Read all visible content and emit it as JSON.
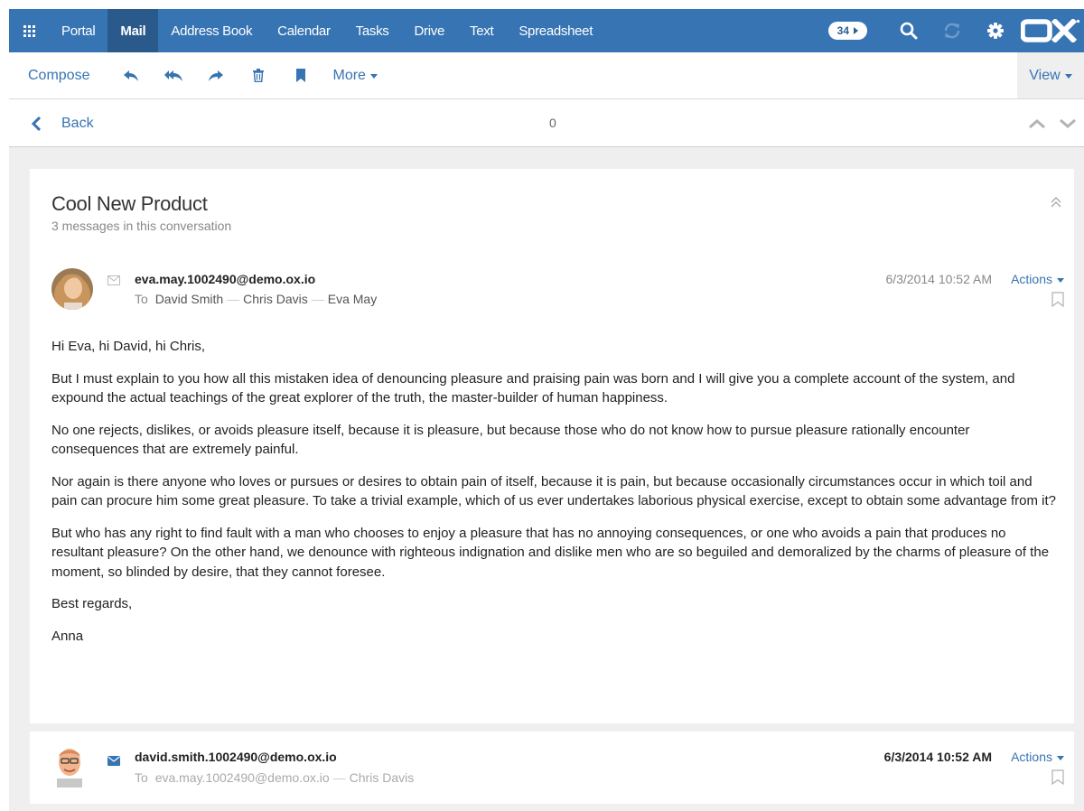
{
  "topbar": {
    "nav": [
      "Portal",
      "Mail",
      "Address Book",
      "Calendar",
      "Tasks",
      "Drive",
      "Text",
      "Spreadsheet"
    ],
    "active": "Mail",
    "notification_count": "34",
    "icons": [
      "apps-icon",
      "search-icon",
      "refresh-icon",
      "gear-icon",
      "ox-logo"
    ],
    "accent": "#3774b3"
  },
  "toolbar": {
    "compose": "Compose",
    "icons": [
      "reply-icon",
      "reply-all-icon",
      "forward-icon",
      "delete-icon",
      "flag-icon"
    ],
    "more": "More",
    "view": "View"
  },
  "detail_bar": {
    "back": "Back",
    "counter": "0"
  },
  "conversation": {
    "subject": "Cool New Product",
    "count_text": "3 messages in this conversation",
    "messages": [
      {
        "from": "eva.may.1002490@demo.ox.io",
        "to_label": "To",
        "to": [
          "David Smith",
          "Chris Davis",
          "Eva May"
        ],
        "date": "6/3/2014 10:52 AM",
        "actions": "Actions",
        "read": true,
        "body": [
          "Hi Eva, hi David, hi Chris,",
          "But I must explain to you how all this mistaken idea of denouncing pleasure and praising pain was born and I will give you a complete account of the system, and expound the actual teachings of the great explorer of the truth, the master-builder of human happiness.",
          "No one rejects, dislikes, or avoids pleasure itself, because it is pleasure, but because those who do not know how to pursue pleasure rationally encounter consequences that are extremely painful.",
          "Nor again is there anyone who loves or pursues or desires to obtain pain of itself, because it is pain, but because occasionally circumstances occur in which toil and pain can procure him some great pleasure. To take a trivial example, which of us ever undertakes laborious physical exercise, except to obtain some advantage from it?",
          "But who has any right to find fault with a man who chooses to enjoy a pleasure that has no annoying consequences, or one who avoids a pain that produces no resultant pleasure? On the other hand, we denounce with righteous indignation and dislike men who are so beguiled and demoralized by the charms of pleasure of the moment, so blinded by desire, that they cannot foresee.",
          "Best regards,",
          "Anna"
        ]
      },
      {
        "from": "david.smith.1002490@demo.ox.io",
        "to_label": "To",
        "to": [
          "eva.may.1002490@demo.ox.io",
          "Chris Davis"
        ],
        "date": "6/3/2014 10:52 AM",
        "actions": "Actions",
        "read": false
      }
    ]
  }
}
